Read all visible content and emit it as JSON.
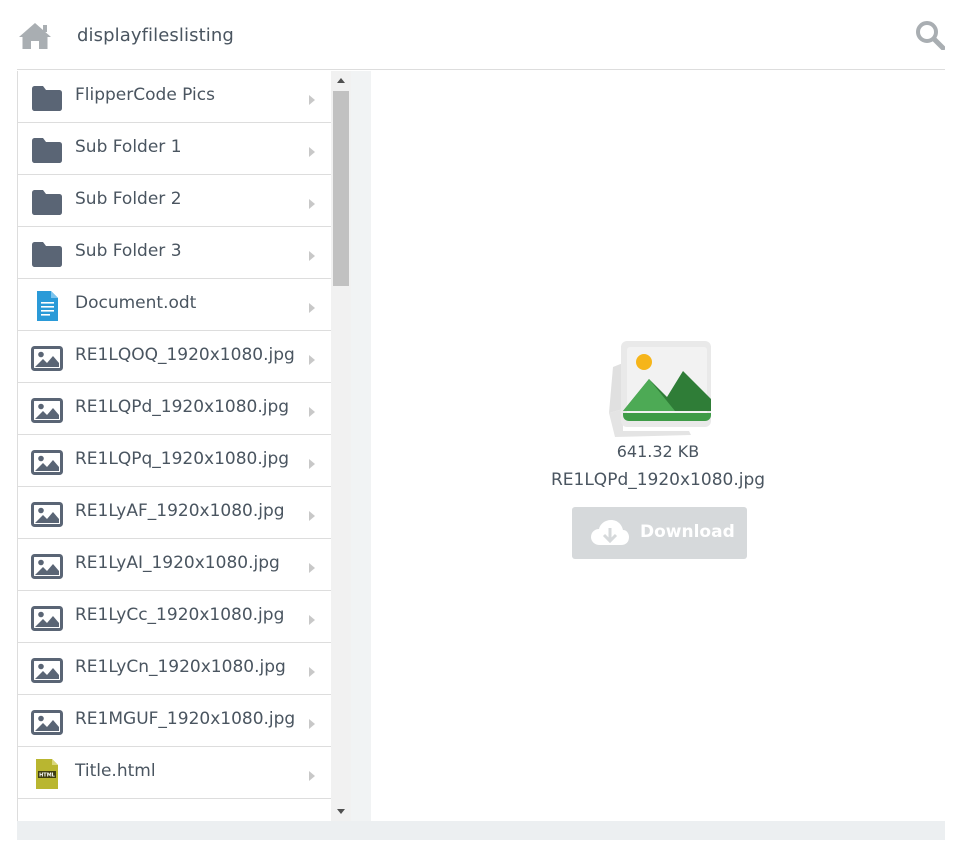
{
  "header": {
    "title": "displayfileslisting",
    "home_icon": "home-icon",
    "search_icon": "search-icon"
  },
  "files": [
    {
      "name": "FlipperCode Pics",
      "type": "folder"
    },
    {
      "name": "Sub Folder 1",
      "type": "folder"
    },
    {
      "name": "Sub Folder 2",
      "type": "folder"
    },
    {
      "name": "Sub Folder 3",
      "type": "folder"
    },
    {
      "name": "Document.odt",
      "type": "document"
    },
    {
      "name": "RE1LQOQ_1920x1080.jpg",
      "type": "image"
    },
    {
      "name": "RE1LQPd_1920x1080.jpg",
      "type": "image"
    },
    {
      "name": "RE1LQPq_1920x1080.jpg",
      "type": "image"
    },
    {
      "name": "RE1LyAF_1920x1080.jpg",
      "type": "image"
    },
    {
      "name": "RE1LyAI_1920x1080.jpg",
      "type": "image"
    },
    {
      "name": "RE1LyCc_1920x1080.jpg",
      "type": "image"
    },
    {
      "name": "RE1LyCn_1920x1080.jpg",
      "type": "image"
    },
    {
      "name": "RE1MGUF_1920x1080.jpg",
      "type": "image"
    },
    {
      "name": "Title.html",
      "type": "html"
    }
  ],
  "preview": {
    "file_size": "641.32 KB",
    "file_name": "RE1LQPd_1920x1080.jpg",
    "download_label": "Download",
    "download_icon": "cloud-download-icon"
  },
  "colors": {
    "folder": "#5a6575",
    "text": "#4a5560",
    "download_bg": "#d6d9db",
    "document": "#2a9ad8",
    "html_icon": "#b9b630",
    "image_green": "#3e9b47"
  }
}
